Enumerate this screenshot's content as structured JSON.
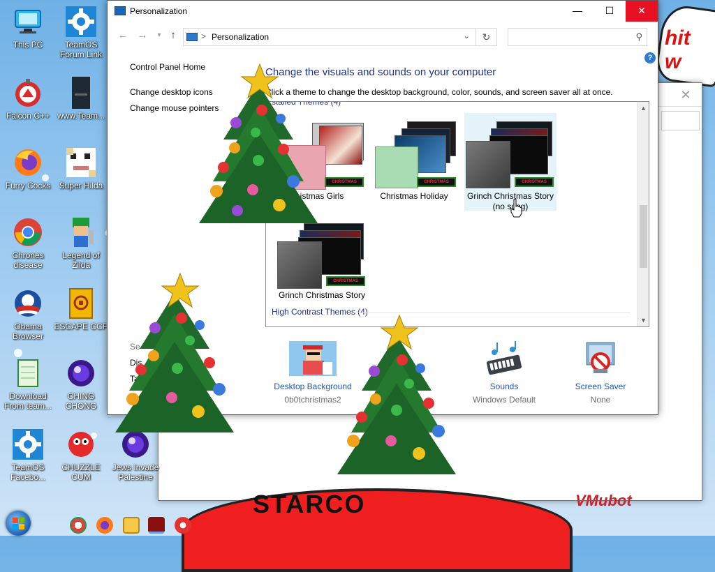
{
  "window": {
    "title": "Personalization",
    "minimize_glyph": "—",
    "maximize_glyph": "☐",
    "close_glyph": "✕"
  },
  "navbar": {
    "back_glyph": "←",
    "forward_glyph": "→",
    "recent_glyph": "▾",
    "up_glyph": "↑",
    "breadcrumb_separator": ">",
    "breadcrumb": "Personalization",
    "address_dropdown_glyph": "⌄",
    "refresh_glyph": "↻",
    "search_placeholder": "",
    "search_glyph": "⚲",
    "help_glyph": "?"
  },
  "sidebar": {
    "home": "Control Panel Home",
    "links": [
      "Change desktop icons",
      "Change mouse pointers"
    ],
    "see_also_partial": [
      "Se",
      "Dis",
      "Tas"
    ]
  },
  "main": {
    "heading": "Change the visuals and sounds on your computer",
    "subheading": "Click a theme to change the desktop background, color, sounds, and screen saver all at once.",
    "group_installed_partial": "stalled Themes (4)",
    "group_high_contrast": "High Contrast Themes (4)",
    "themes": [
      {
        "name": "Christmas Girls",
        "visible_caption": "istmas Girls",
        "selected": false
      },
      {
        "name": "Christmas Holiday",
        "visible_caption": "Christmas Holiday",
        "selected": false
      },
      {
        "name": "Grinch Christmas Story (no song)",
        "visible_caption": "Grinch Christmas Story (no song)",
        "selected": true
      },
      {
        "name": "Grinch Christmas Story",
        "visible_caption": "Grinch Christmas Story",
        "selected": false
      }
    ],
    "badge_text": "CHRISTMAS"
  },
  "bottom": [
    {
      "label": "Desktop Background",
      "value": "0b0tchristmas2"
    },
    {
      "label": "Sounds",
      "value": "Windows Default"
    },
    {
      "label": "Screen Saver",
      "value": "None"
    }
  ],
  "desktop_icons": [
    {
      "label": "This PC",
      "icon": "monitor-icon"
    },
    {
      "label": "TeamOS Forum Link",
      "icon": "gear-icon"
    },
    {
      "label": "Falcon C++",
      "icon": "falcon-icon"
    },
    {
      "label": "www.Team...",
      "icon": "book-icon"
    },
    {
      "label": "Furry Cocks",
      "icon": "firefox-icon"
    },
    {
      "label": "Super Hilda",
      "icon": "pixel-face-icon"
    },
    {
      "label": "Chrones disease",
      "icon": "chrome-icon"
    },
    {
      "label": "Legend of Zilda",
      "icon": "hero-icon"
    },
    {
      "label": "Obama Browser",
      "icon": "obama-logo-icon"
    },
    {
      "label": "ESCAPE CCP",
      "icon": "mahjong-icon"
    },
    {
      "label": "Download From team...",
      "icon": "notepad-icon"
    },
    {
      "label": "CHING CHONG",
      "icon": "ball-icon"
    },
    {
      "label": "TeamOS Facebo...",
      "icon": "gear-icon"
    },
    {
      "label": "CHUZZLE CUM",
      "icon": "fuzzball-icon"
    },
    {
      "label": "Jews Invade Palestine",
      "icon": "ball-icon"
    }
  ],
  "wallpaper_text": {
    "sign": "hit\nw",
    "starco": "STARCO",
    "signature": "VMubot"
  },
  "colors": {
    "accent_link": "#1e58b2",
    "heading": "#1e3287",
    "close_red": "#e81123",
    "selection": "#e5f3fb"
  }
}
